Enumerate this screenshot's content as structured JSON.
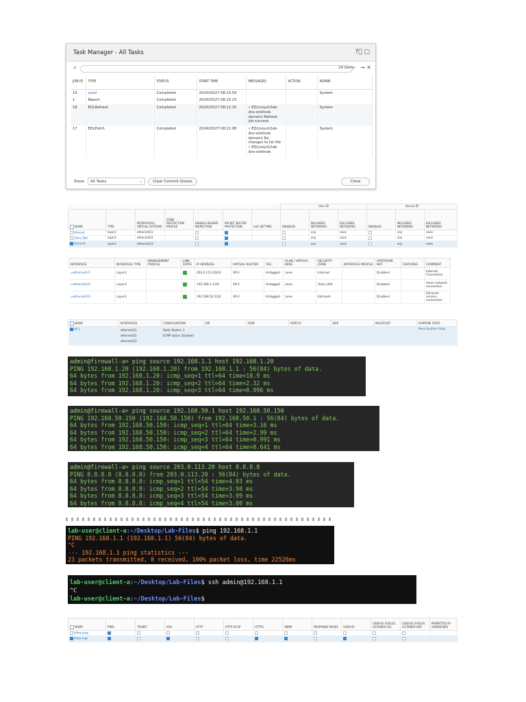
{
  "task_manager": {
    "title": "Task Manager - All Tasks",
    "items_count": "14 items",
    "columns": [
      "JOB ID",
      "TYPE",
      "STATUS",
      "START TIME",
      "MESSAGES",
      "ACTION",
      "ADMIN"
    ],
    "rows": [
      {
        "id": "19",
        "type": "Load",
        "status": "Completed",
        "start": "2024/03/27 08:15:54",
        "messages": [],
        "action": "",
        "admin": "System"
      },
      {
        "id": "1",
        "type": "Report",
        "status": "Completed",
        "start": "2024/03/27 08:15:23",
        "messages": [],
        "action": "",
        "admin": ""
      },
      {
        "id": "18",
        "type": "EDLRefresh",
        "status": "Completed",
        "start": "2024/03/27 08:11:10",
        "messages": [
          "EDL(vsys1/lab-dns-sinkhole domain) Refresh job success"
        ],
        "action": "",
        "admin": "System"
      },
      {
        "id": "17",
        "type": "EDLFetch",
        "status": "Completed",
        "start": "2024/03/27 08:11:08",
        "messages": [
          "EDL(vsys1/lab-dns-sinkhole domain) No changes to list file",
          "EDL(vsys1/lab-dns-sinkhole"
        ],
        "action": "",
        "admin": "System"
      }
    ],
    "show_label": "Show",
    "show_value": "All Tasks",
    "clear_button": "Clear Commit Queue",
    "close_button": "Close"
  },
  "zones": {
    "group_userid": "User ID",
    "group_deviceid": "Device ID",
    "columns": [
      "NAME",
      "TYPE",
      "INTERFACES / VIRTUAL SYSTEMS",
      "ZONE PROTECTION PROFILE",
      "ENABLE HEADER INSPECTION",
      "PACKET BUFFER PROTECTION",
      "LOG SETTING",
      "ENABLED",
      "INCLUDED NETWORKS",
      "EXCLUDED NETWORKS",
      "ENABLED",
      "INCLUDED NETWORKS",
      "EXCLUDED NETWORKS"
    ],
    "rows": [
      {
        "name": "Internet",
        "type": "layer3",
        "iface": "ethernet1/1",
        "incl": "any",
        "excl": "none",
        "dincl": "any",
        "dexcl": "none",
        "selected": false
      },
      {
        "name": "Users_Net",
        "type": "layer3",
        "iface": "ethernet1/2",
        "incl": "any",
        "excl": "none",
        "dincl": "any",
        "dexcl": "none",
        "selected": false
      },
      {
        "name": "Extranet",
        "type": "layer3",
        "iface": "ethernet1/3",
        "incl": "any",
        "excl": "none",
        "dincl": "any",
        "dexcl": "none",
        "selected": true
      }
    ]
  },
  "interfaces": {
    "columns": [
      "INTERFACE",
      "INTERFACE TYPE",
      "MANAGEMENT PROFILE",
      "LINK STATE",
      "IP ADDRESS",
      "VIRTUAL ROUTER",
      "TAG",
      "VLAN / VIRTUAL-WIRE",
      "SECURITY ZONE",
      "INTERFACE PROFILE",
      "UPSTREAM NAT",
      "FEATURES",
      "COMMENT"
    ],
    "rows": [
      {
        "iface": "ethernet1/1",
        "type": "Layer3",
        "ip": "203.0.113.20/24",
        "vr": "VR-1",
        "tag": "Untagged",
        "vlan": "none",
        "zone": "Internet",
        "nat": "Disabled",
        "comment": "Internet Connection"
      },
      {
        "iface": "ethernet1/2",
        "type": "Layer3",
        "ip": "192.168.1.1/24",
        "vr": "VR-1",
        "tag": "Untagged",
        "vlan": "none",
        "zone": "Users_Net",
        "nat": "Disabled",
        "comment": "Users network connection"
      },
      {
        "iface": "ethernet1/3",
        "type": "Layer3",
        "ip": "192.168.50.1/24",
        "vr": "VR-1",
        "tag": "Untagged",
        "vlan": "none",
        "zone": "Extranet",
        "nat": "Disabled",
        "comment": "Extranet servers connection"
      }
    ]
  },
  "virtual_routers": {
    "columns": [
      "NAME",
      "INTERFACES",
      "CONFIGURATION",
      "RIP",
      "OSPF",
      "OSPFV3",
      "BGP",
      "MULTICAST",
      "RUNTIME STATS"
    ],
    "row": {
      "name": "VR-1",
      "interfaces": [
        "ethernet1/1",
        "ethernet1/2",
        "ethernet1/3"
      ],
      "config": [
        "Static Routes: 1",
        "ECMP status: Disabled"
      ],
      "runtime": "More Runtime Stats"
    }
  },
  "terminal1": {
    "lines": [
      "admin@firewall-a> ping source 192.168.1.1 host 192.168.1.20",
      "PING 192.168.1.20 (192.168.1.20) from 192.168.1.1 : 56(84) bytes of data.",
      "64 bytes from 192.168.1.20: icmp_seq=1 ttl=64 time=18.9 ms",
      "64 bytes from 192.168.1.20: icmp_seq=2 ttl=64 time=2.32 ms",
      "64 bytes from 192.168.1.20: icmp_seq=3 ttl=64 time=0.996 ms"
    ]
  },
  "terminal2": {
    "lines": [
      "admin@firewall-a> ping source 192.168.50.1 host 192.168.50.150",
      "PING 192.168.50.150 (192.168.50.150) from 192.168.50.1 : 56(84) bytes of data.",
      "64 bytes from 192.168.50.150: icmp_seq=1 ttl=64 time=3.16 ms",
      "64 bytes from 192.168.50.150: icmp_seq=2 ttl=64 time=2.99 ms",
      "64 bytes from 192.168.50.150: icmp_seq=3 ttl=64 time=0.991 ms",
      "64 bytes from 192.168.50.150: icmp_seq=4 ttl=64 time=0.641 ms"
    ]
  },
  "terminal3": {
    "lines": [
      "admin@firewall-a> ping source 203.0.113.20 host 8.8.8.8",
      "PING 8.8.8.8 (8.8.8.8) from 203.0.113.20 : 56(84) bytes of data.",
      "64 bytes from 8.8.8.8: icmp_seq=1 ttl=54 time=4.03 ms",
      "64 bytes from 8.8.8.8: icmp_seq=2 ttl=54 time=3.98 ms",
      "64 bytes from 8.8.8.8: icmp_seq=3 ttl=54 time=3.99 ms",
      "64 bytes from 8.8.8.8: icmp_seq=4 ttl=54 time=3.00 ms"
    ]
  },
  "terminal4": {
    "user": "lab-user@client-a",
    "path": ":~/Desktop/Lab-Files",
    "cmd": "$ ping 192.168.1.1",
    "out": [
      "PING 192.168.1.1 (192.168.1.1) 56(84) bytes of data.",
      "^C",
      "--- 192.168.1.1 ping statistics ---",
      "23 packets transmitted, 0 received, 100% packet loss, time 22526ms"
    ]
  },
  "terminal5": {
    "user": "lab-user@client-a",
    "path": ":~/Desktop/Lab-Files",
    "cmd": "$ ssh admin@192.168.1.1",
    "ctrl": "^C",
    "prompt_end": "$"
  },
  "mgmt_profiles": {
    "columns": [
      "NAME",
      "PING",
      "TELNET",
      "SSH",
      "HTTP",
      "HTTP OCSP",
      "HTTPS",
      "SNMP",
      "RESPONSE PAGES",
      "USER-ID",
      "USER-ID SYSLOG LISTENER-SSL",
      "USER-ID SYSLOG LISTENER-UDP",
      "PERMITTED IP ADDRESSES"
    ],
    "rows": [
      {
        "name": "Allow-ping",
        "flags": [
          true,
          false,
          false,
          false,
          false,
          false,
          false,
          false,
          false,
          false,
          false
        ],
        "selected": false
      },
      {
        "name": "Allow-mgt",
        "flags": [
          true,
          false,
          true,
          false,
          false,
          true,
          true,
          false,
          true,
          false,
          false
        ],
        "selected": true
      }
    ]
  }
}
